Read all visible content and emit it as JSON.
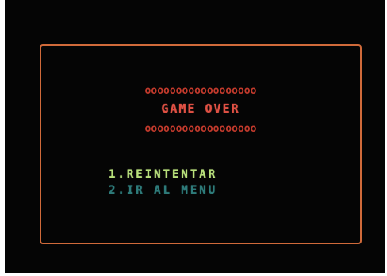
{
  "game": {
    "title": "GAME OVER",
    "decoration_row": "oooooooooooooooooo",
    "options": [
      {
        "label": "1.REINTENTAR",
        "state": "selected",
        "color": "#b7e07a"
      },
      {
        "label": "2.IR AL MENU",
        "state": "unselected",
        "color": "#2e7b7a"
      }
    ]
  },
  "colors": {
    "background": "#050505",
    "frame": "#d06a3a",
    "title": "#e05043",
    "decorations": "#c23a2c"
  }
}
